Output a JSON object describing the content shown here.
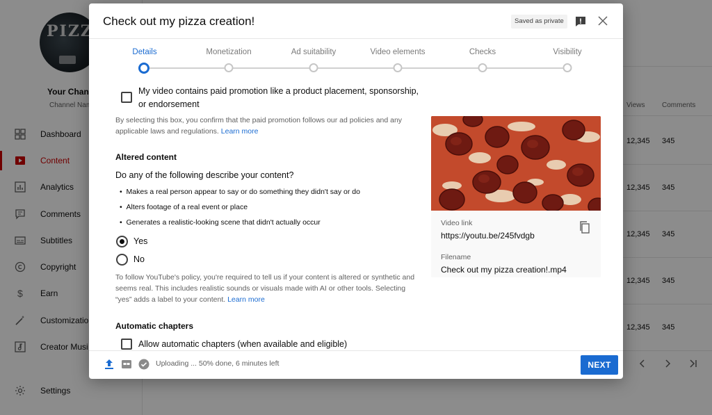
{
  "sidebar": {
    "channel_name": "Your Chann",
    "channel_sub": "Channel Nam",
    "avatar_text": "PIZZA",
    "items": [
      {
        "label": "Dashboard",
        "icon": "dashboard-icon"
      },
      {
        "label": "Content",
        "icon": "content-icon",
        "active": true
      },
      {
        "label": "Analytics",
        "icon": "analytics-icon"
      },
      {
        "label": "Comments",
        "icon": "comments-icon"
      },
      {
        "label": "Subtitles",
        "icon": "subtitles-icon"
      },
      {
        "label": "Copyright",
        "icon": "copyright-icon"
      },
      {
        "label": "Earn",
        "icon": "earn-icon"
      },
      {
        "label": "Customizatio",
        "icon": "customization-icon"
      },
      {
        "label": "Creator Musi",
        "icon": "creator-music-icon"
      },
      {
        "label": "Settings",
        "icon": "settings-icon"
      }
    ]
  },
  "table": {
    "columns": [
      "Views",
      "Comments"
    ],
    "rows": [
      {
        "views": "12,345",
        "comments": "345"
      },
      {
        "views": "12,345",
        "comments": "345"
      },
      {
        "views": "12,345",
        "comments": "345"
      },
      {
        "views": "12,345",
        "comments": "345"
      },
      {
        "views": "12,345",
        "comments": "345"
      }
    ]
  },
  "dialog": {
    "title": "Check out my pizza creation!",
    "saved_badge": "Saved as private",
    "steps": [
      {
        "label": "Details",
        "active": true
      },
      {
        "label": "Monetization"
      },
      {
        "label": "Ad suitability"
      },
      {
        "label": "Video elements"
      },
      {
        "label": "Checks"
      },
      {
        "label": "Visibility"
      }
    ],
    "paid_promotion": {
      "label_line1": "My video contains paid promotion like a product placement, sponsorship,",
      "label_line2": "or endorsement",
      "help_line1": "By selecting this box, you confirm that the paid promotion follows our ad policies and any",
      "help_line2": "applicable laws and regulations.",
      "learn_more": "Learn more",
      "checked": false
    },
    "altered_content": {
      "heading": "Altered content",
      "question": "Do any of the following describe your content?",
      "bullets": [
        "Makes a real person appear to say or do something they didn't say or do",
        "Alters footage of a real event or place",
        "Generates a realistic-looking scene that didn't actually occur"
      ],
      "options": [
        {
          "label": "Yes",
          "checked": true
        },
        {
          "label": "No",
          "checked": false
        }
      ],
      "policy_line1": "To follow YouTube's policy, you're required to tell us if your content is altered or synthetic and",
      "policy_line2": "seems real. This includes realistic sounds or visuals made with AI or other tools. Selecting",
      "policy_line3": "“yes” adds a label to your content.",
      "learn_more": "Learn more"
    },
    "chapters": {
      "heading": "Automatic chapters",
      "checkbox_label": "Allow automatic chapters (when available and eligible)",
      "checked": false
    },
    "preview": {
      "video_link_label": "Video link",
      "video_link": "https://youtu.be/245fvdgb",
      "filename_label": "Filename",
      "filename": "Check out my pizza creation!.mp4"
    },
    "footer": {
      "status": "Uploading ... 50% done, 6 minutes left",
      "next_label": "NEXT"
    }
  },
  "colors": {
    "accent": "#1a6bd1",
    "active_nav": "#cc0000"
  }
}
